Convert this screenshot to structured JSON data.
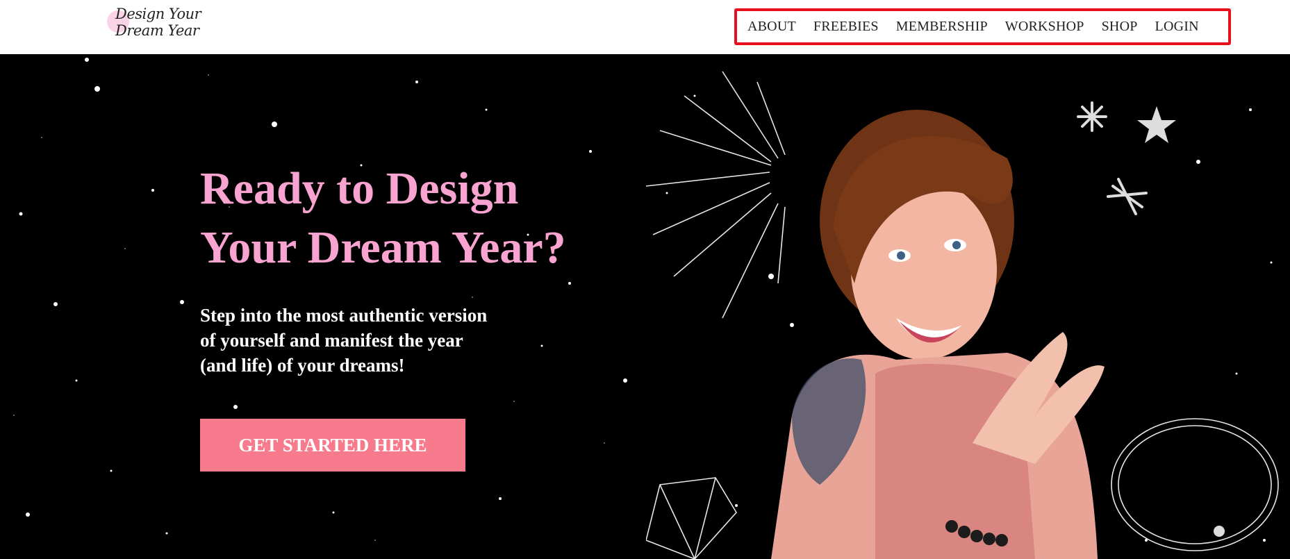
{
  "header": {
    "logo_text": "Design Your Dream Year",
    "nav": [
      {
        "label": "ABOUT"
      },
      {
        "label": "FREEBIES"
      },
      {
        "label": "MEMBERSHIP"
      },
      {
        "label": "WORKSHOP"
      },
      {
        "label": "SHOP"
      },
      {
        "label": "LOGIN"
      }
    ],
    "nav_highlight_color": "#e8101c"
  },
  "hero": {
    "headline_line1": "Ready to Design",
    "headline_line2": "Your Dream Year?",
    "subtext_line1": "Step into the most authentic version",
    "subtext_line2": "of yourself and manifest the year",
    "subtext_line3": "(and life) of your dreams!",
    "cta_label": "GET STARTED HERE",
    "colors": {
      "background": "#000000",
      "headline": "#f9a3d1",
      "cta": "#f77b8d",
      "subtext": "#ffffff"
    },
    "image_description_icon": "portrait-photo"
  }
}
